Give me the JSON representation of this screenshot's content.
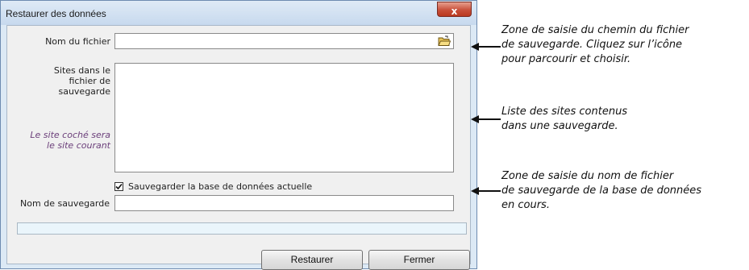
{
  "dialog": {
    "title": "Restaurer des données",
    "close_label": "x"
  },
  "form": {
    "filename_label": "Nom du fichier",
    "filename_value": "",
    "sites_label_lines": [
      "Sites dans le",
      "fichier de",
      "sauvegarde"
    ],
    "sites_hint_lines": [
      "Le site coché sera",
      "le site courant"
    ],
    "sites_items": [],
    "backup_checkbox_label": "Sauvegarder la base de données actuelle",
    "backup_checked": true,
    "backup_name_label": "Nom de sauvegarde",
    "backup_name_value": "",
    "progress": 0
  },
  "buttons": {
    "restore": "Restaurer",
    "close": "Fermer"
  },
  "annotations": [
    {
      "lines": [
        "Zone de saisie du chemin du fichier",
        "de sauvegarde. Cliquez sur l’icône",
        "pour parcourir et choisir."
      ]
    },
    {
      "lines": [
        "Liste des sites contenus",
        "dans une sauvegarde."
      ]
    },
    {
      "lines": [
        "Zone de saisie du nom de fichier",
        "de sauvegarde de la base de données",
        "en cours."
      ]
    }
  ],
  "colors": {
    "window_border": "#6d8bb0",
    "title_gradient_top": "#dfeaf6",
    "close_button": "#c8503a",
    "hint_text": "#6b3f7a",
    "progress_track": "#eaf5fb"
  },
  "icons": {
    "browse": "folder-open-icon",
    "close": "close-icon",
    "check": "checkmark-icon"
  }
}
